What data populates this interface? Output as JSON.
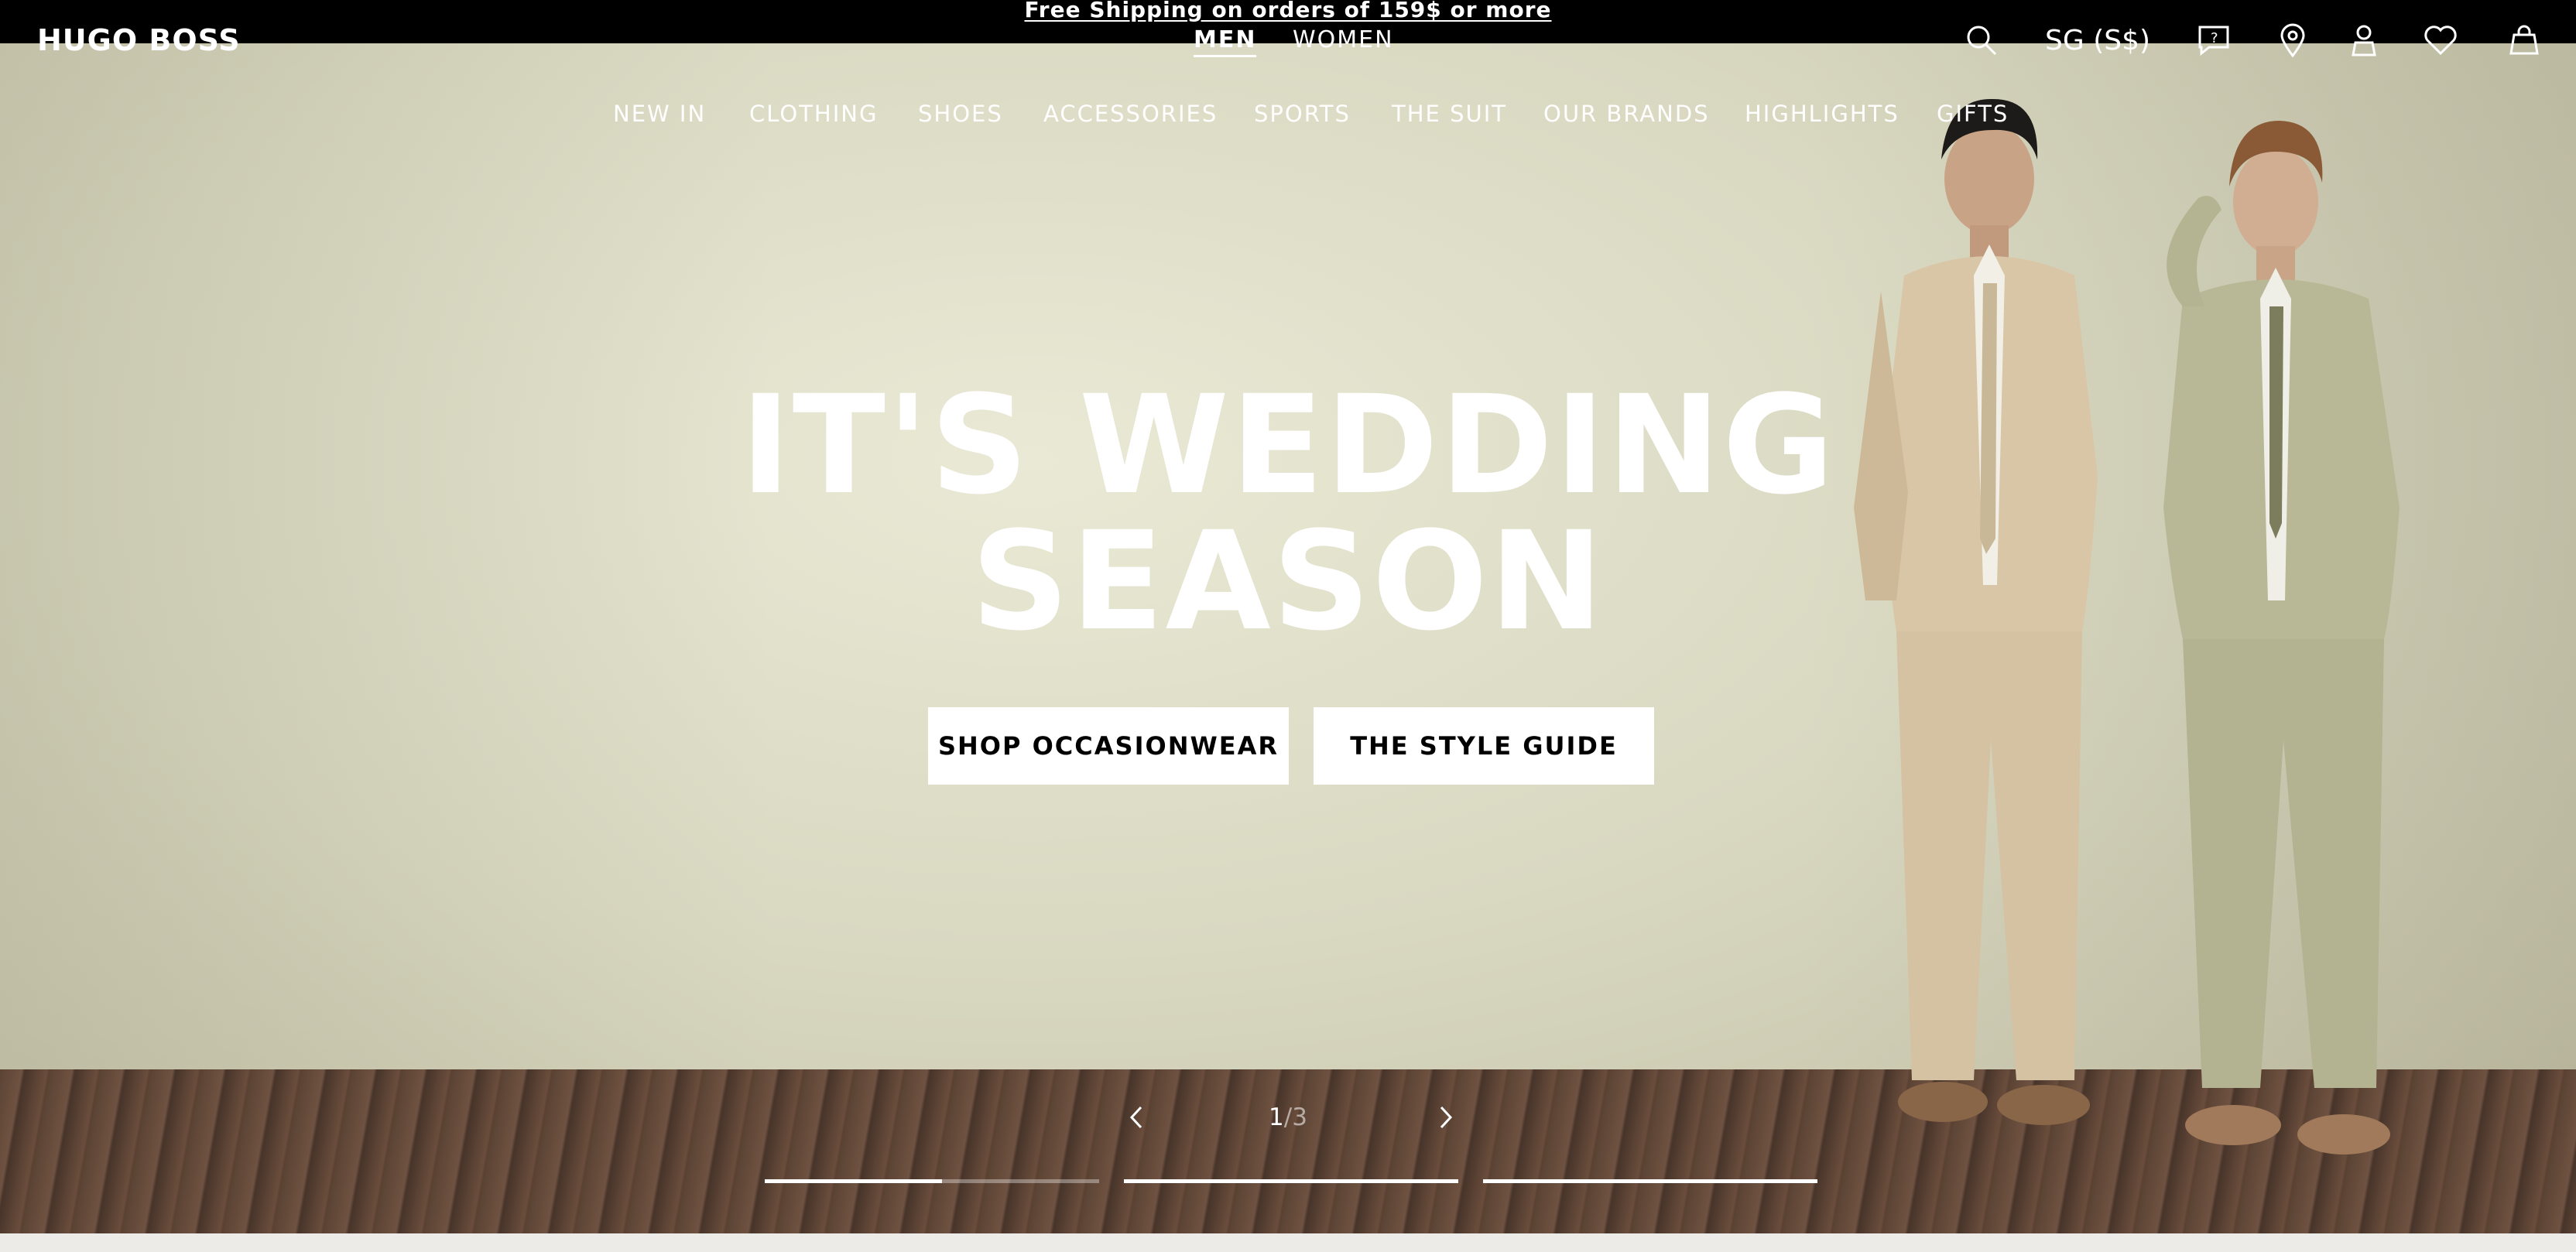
{
  "promo": {
    "text": "Free Shipping on orders of 159$  or more"
  },
  "brand": {
    "logo": "HUGO BOSS"
  },
  "gender_tabs": [
    {
      "label": "MEN",
      "active": true
    },
    {
      "label": "WOMEN",
      "active": false
    }
  ],
  "utility": {
    "currency": "SG (S$)",
    "icons": [
      "search-icon",
      "help-chat-icon",
      "store-locator-icon",
      "account-icon",
      "wishlist-icon",
      "bag-icon"
    ]
  },
  "nav": {
    "items": [
      "NEW IN",
      "CLOTHING",
      "SHOES",
      "ACCESSORIES",
      "SPORTS",
      "THE SUIT",
      "OUR BRANDS",
      "HIGHLIGHTS",
      "GIFTS"
    ]
  },
  "hero": {
    "headline_line1": "IT'S WEDDING",
    "headline_line2": "SEASON",
    "cta_primary": "SHOP OCCASIONWEAR",
    "cta_secondary": "THE STYLE GUIDE"
  },
  "slider": {
    "current": "1",
    "separator": "/",
    "total": "3",
    "progress": [
      0.53,
      1.0,
      1.0
    ]
  },
  "colors": {
    "topbar": "#000000",
    "hero_bg": "#dcdbc4",
    "button_bg": "#ffffff"
  }
}
